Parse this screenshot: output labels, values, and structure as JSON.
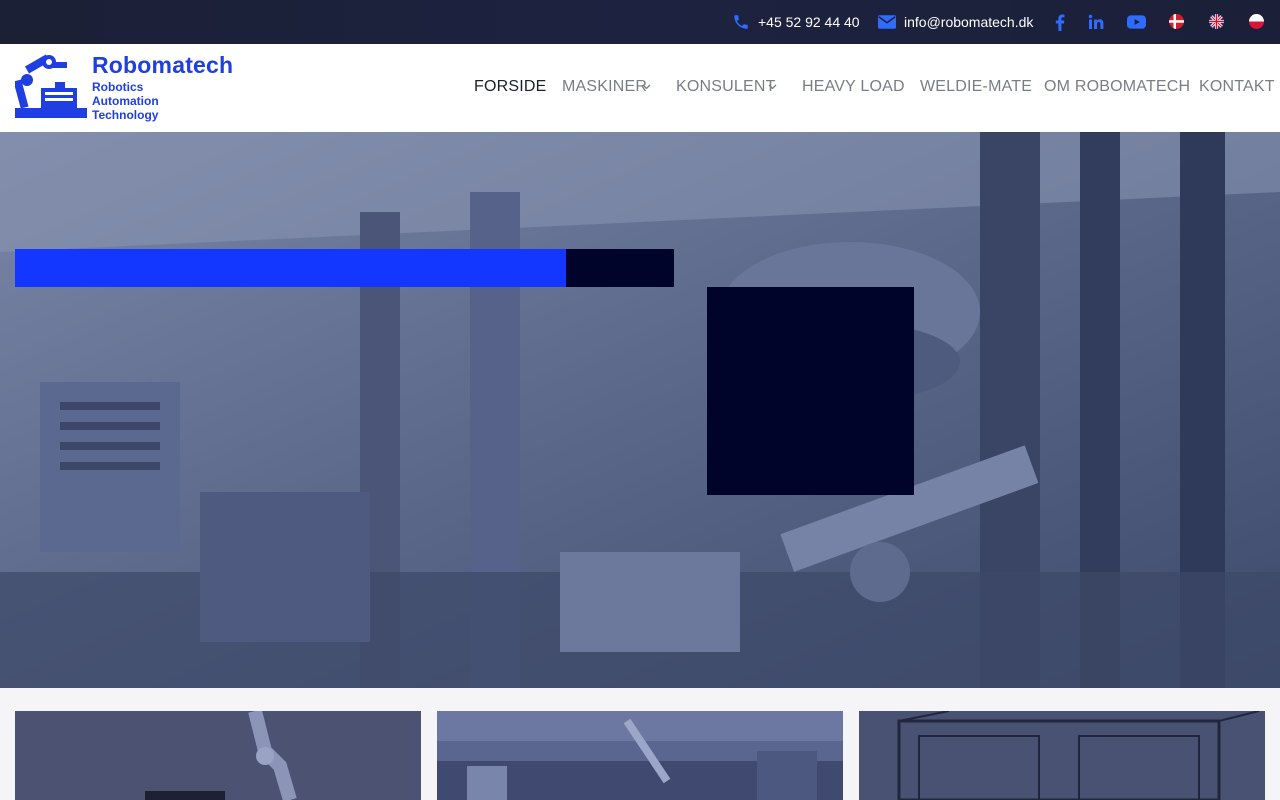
{
  "topbar": {
    "phone": "+45 52 92 44 40",
    "email": "info@robomatech.dk",
    "phone_icon": "phone-icon",
    "email_icon": "envelope-icon",
    "socials": [
      "facebook-icon",
      "linkedin-icon",
      "youtube-icon"
    ],
    "languages": [
      "danish-flag",
      "english-flag",
      "polish-flag"
    ]
  },
  "logo": {
    "title": "Robomatech",
    "line1": "Robotics",
    "line2": "Automation",
    "line3": "Technology"
  },
  "nav": {
    "items": [
      {
        "label": "FORSIDE",
        "active": true
      },
      {
        "label": "MASKINER",
        "dropdown": true
      },
      {
        "label": "KONSULENT",
        "dropdown": true
      },
      {
        "label": "HEAVY LOAD"
      },
      {
        "label": "WELDIE-MATE"
      },
      {
        "label": "OM ROBOMATECH"
      },
      {
        "label": "KONTAKT"
      }
    ]
  },
  "colors": {
    "accent": "#1437ff",
    "dark": "#00042a",
    "topbar": "#1b2036"
  }
}
